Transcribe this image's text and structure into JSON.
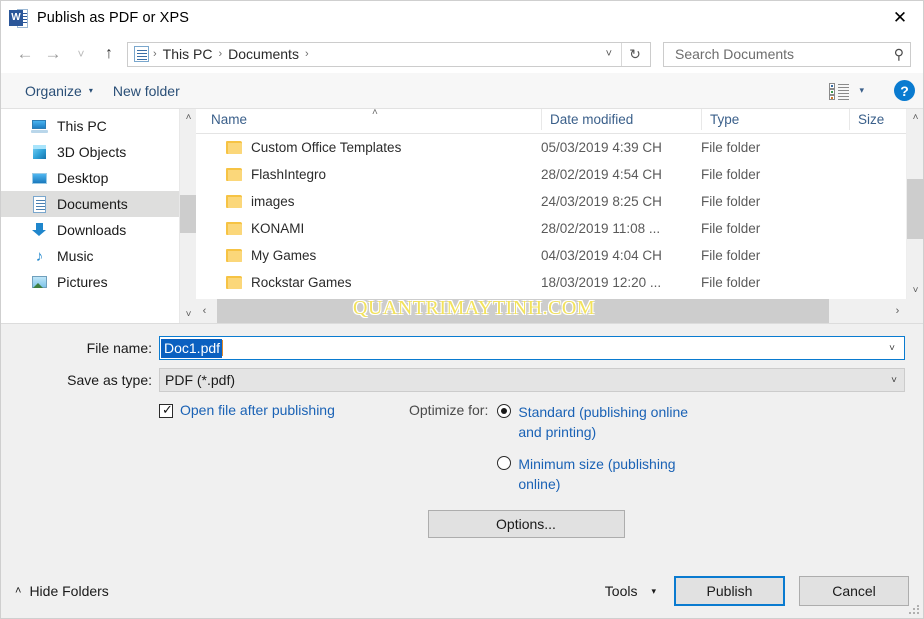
{
  "window": {
    "title": "Publish as PDF or XPS",
    "app_icon": "word-icon",
    "close_label": "✕"
  },
  "address_bar": {
    "back_icon": "←",
    "forward_icon": "→",
    "recent_icon": "˅",
    "up_icon": "↑",
    "path_icon": "documents-folder-icon",
    "breadcrumbs": [
      "This PC",
      "Documents"
    ],
    "separator": "›",
    "dropdown_caret": "˅",
    "refresh_icon": "↻",
    "search": {
      "placeholder": "Search Documents",
      "value": "",
      "icon": "⚲"
    }
  },
  "command_bar": {
    "organize_label": "Organize",
    "organize_caret": "▾",
    "new_folder_label": "New folder",
    "view_caret": "▾",
    "help_label": "?"
  },
  "sidebar": {
    "items": [
      {
        "label": "This PC",
        "icon": "pc-icon",
        "selected": false
      },
      {
        "label": "3D Objects",
        "icon": "cube-icon",
        "selected": false
      },
      {
        "label": "Desktop",
        "icon": "monitor-icon",
        "selected": false
      },
      {
        "label": "Documents",
        "icon": "document-icon",
        "selected": true
      },
      {
        "label": "Downloads",
        "icon": "download-arrow-icon",
        "selected": false
      },
      {
        "label": "Music",
        "icon": "music-note-icon",
        "selected": false
      },
      {
        "label": "Pictures",
        "icon": "picture-icon",
        "selected": false
      }
    ],
    "scroll_up": "˄",
    "scroll_down": "˅"
  },
  "file_list": {
    "columns": [
      "Name",
      "Date modified",
      "Type",
      "Size"
    ],
    "sort_indicator": "˄",
    "rows": [
      {
        "name": "Custom Office Templates",
        "date": "05/03/2019 4:39 CH",
        "type": "File folder",
        "size": ""
      },
      {
        "name": "FlashIntegro",
        "date": "28/02/2019 4:54 CH",
        "type": "File folder",
        "size": ""
      },
      {
        "name": "images",
        "date": "24/03/2019 8:25 CH",
        "type": "File folder",
        "size": ""
      },
      {
        "name": "KONAMI",
        "date": "28/02/2019 11:08 ...",
        "type": "File folder",
        "size": ""
      },
      {
        "name": "My Games",
        "date": "04/03/2019 4:04 CH",
        "type": "File folder",
        "size": ""
      },
      {
        "name": "Rockstar Games",
        "date": "18/03/2019 12:20 ...",
        "type": "File folder",
        "size": ""
      }
    ],
    "hscroll_left": "‹",
    "hscroll_right": "›",
    "vscroll_up": "˄",
    "vscroll_down": "˅"
  },
  "watermark": {
    "text": "QUANTRIMAYTINH.COM",
    "color": "#f2e25c"
  },
  "form": {
    "file_name_label": "File name:",
    "file_name_value": "Doc1.pdf",
    "save_as_type_label": "Save as type:",
    "save_as_type_value": "PDF (*.pdf)",
    "combo_caret": "˅",
    "open_after_publishing_label": "Open file after publishing",
    "open_after_publishing_checked": true,
    "check_glyph": "✓",
    "optimize_label": "Optimize for:",
    "optimize_options": [
      {
        "label": "Standard (publishing online and printing)",
        "selected": true
      },
      {
        "label": "Minimum size (publishing online)",
        "selected": false
      }
    ],
    "options_button_label": "Options..."
  },
  "footer": {
    "hide_folders_label": "Hide Folders",
    "hide_folders_chevron": "˄",
    "tools_label": "Tools",
    "tools_caret": "▾",
    "publish_label": "Publish",
    "cancel_label": "Cancel"
  },
  "colors": {
    "accent": "#0a7bd0",
    "link": "#1a62b5",
    "selection": "#0a60c0",
    "folder": "#f6c344",
    "dialog_bg": "#f0f0f0"
  }
}
